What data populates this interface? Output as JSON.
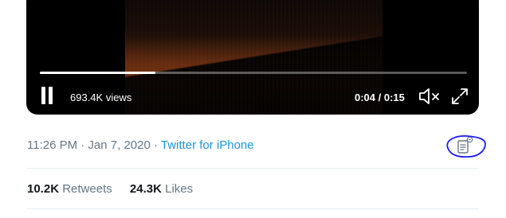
{
  "video": {
    "views": "693.4K views",
    "time": "0:04 / 0:15",
    "progress_fraction": 0.27,
    "state": "playing"
  },
  "meta": {
    "timestamp": "11:26 PM · Jan 7, 2020 · ",
    "source": "Twitter for iPhone"
  },
  "stats": {
    "retweets_count": "10.2K",
    "retweets_label": "Retweets",
    "likes_count": "24.3K",
    "likes_label": "Likes"
  },
  "icons": {
    "pause": "pause-icon",
    "mute": "volume-muted-icon",
    "expand": "fullscreen-icon",
    "analytics": "tweet-analytics-icon"
  },
  "colors": {
    "link": "#1b95e0",
    "secondary_text": "#657786",
    "primary_text": "#14171a",
    "annotation_circle": "#1a1aff"
  }
}
